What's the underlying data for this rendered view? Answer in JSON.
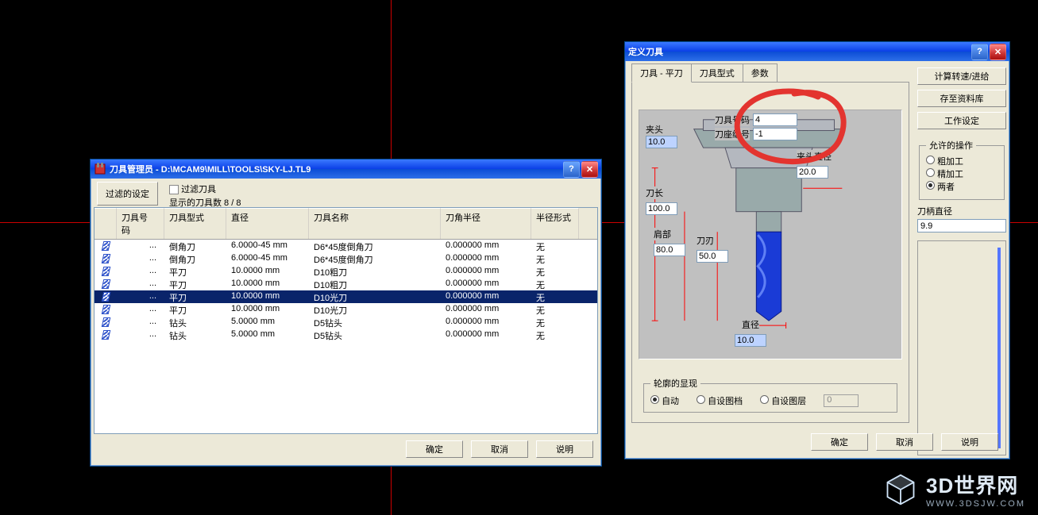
{
  "toolmgr": {
    "title": "刀具管理员  -  D:\\MCAM9\\MILL\\TOOLS\\SKY-LJ.TL9",
    "filter_btn": "过滤的设定",
    "filter_chk_label": "过滤刀具",
    "display_count": "显示的刀具数 8 / 8",
    "headers": {
      "num": "刀具号码",
      "type": "刀具型式",
      "dia": "直径",
      "name": "刀具名称",
      "rad": "刀角半径",
      "rtype": "半径形式"
    },
    "rows": [
      {
        "num": "...",
        "type": "倒角刀",
        "dia": "6.0000-45 mm",
        "name": "D6*45度倒角刀",
        "rad": "0.000000 mm",
        "rtype": "无",
        "sel": false
      },
      {
        "num": "...",
        "type": "倒角刀",
        "dia": "6.0000-45 mm",
        "name": "D6*45度倒角刀",
        "rad": "0.000000 mm",
        "rtype": "无",
        "sel": false
      },
      {
        "num": "...",
        "type": "平刀",
        "dia": "10.0000 mm",
        "name": "D10粗刀",
        "rad": "0.000000 mm",
        "rtype": "无",
        "sel": false
      },
      {
        "num": "...",
        "type": "平刀",
        "dia": "10.0000 mm",
        "name": "D10粗刀",
        "rad": "0.000000 mm",
        "rtype": "无",
        "sel": false
      },
      {
        "num": "...",
        "type": "平刀",
        "dia": "10.0000 mm",
        "name": "D10光刀",
        "rad": "0.000000 mm",
        "rtype": "无",
        "sel": true
      },
      {
        "num": "...",
        "type": "平刀",
        "dia": "10.0000 mm",
        "name": "D10光刀",
        "rad": "0.000000 mm",
        "rtype": "无",
        "sel": false
      },
      {
        "num": "...",
        "type": "钻头",
        "dia": "5.0000 mm",
        "name": "D5钻头",
        "rad": "0.000000 mm",
        "rtype": "无",
        "sel": false
      },
      {
        "num": "...",
        "type": "钻头",
        "dia": "5.0000 mm",
        "name": "D5钻头",
        "rad": "0.000000 mm",
        "rtype": "无",
        "sel": false
      }
    ],
    "ok": "确定",
    "cancel": "取消",
    "help": "说明"
  },
  "tooldef": {
    "title": "定义刀具",
    "tabs": {
      "t1": "刀具 - 平刀",
      "t2": "刀具型式",
      "t3": "参数"
    },
    "labels": {
      "holder": "夹头",
      "toolnum": "刀具号码",
      "comp": "刀座编号",
      "headdia": "夹头直径",
      "toollen": "刀长",
      "shoulder": "肩部",
      "cutlen": "刀刃",
      "dia": "直径",
      "profile_group": "轮廓的显现",
      "auto": "自动",
      "custom_file": "自设图档",
      "custom_layer": "自设图层"
    },
    "values": {
      "holder": "10.0",
      "toolnum": "4",
      "comp": "-1",
      "headdia": "20.0",
      "toollen": "100.0",
      "shoulder": "80.0",
      "cutlen": "50.0",
      "dia": "10.0",
      "layer_val": "0"
    },
    "right": {
      "calc": "计算转速/进给",
      "savedb": "存至资料库",
      "worksetup": "工作设定",
      "allowed_group": "允许的操作",
      "rough": "粗加工",
      "finish": "精加工",
      "both": "两者",
      "handle_dia_lbl": "刀柄直径",
      "handle_dia_val": "9.9"
    },
    "ok": "确定",
    "cancel": "取消",
    "help": "说明"
  },
  "watermark": {
    "name": "3D世界网",
    "url": "WWW.3DSJW.COM"
  }
}
